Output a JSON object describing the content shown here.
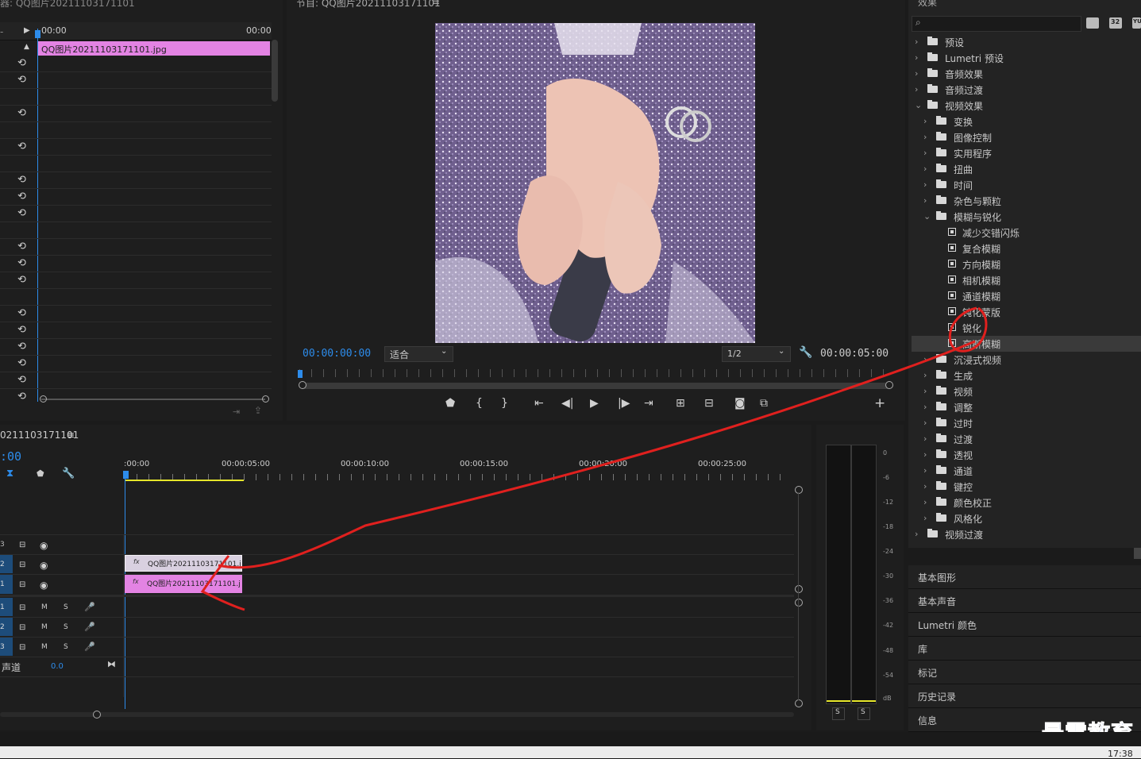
{
  "source_panel": {
    "title": "器: QQ图片20211103171101",
    "time_start": "00:00",
    "time_end": "00:00",
    "clip_label": "QQ图片20211103171101.jpg"
  },
  "program_panel": {
    "title": "节目: QQ图片20211103171101",
    "menu_glyph": "≡",
    "current_time": "00:00:00:00",
    "fit_label": "适合",
    "resolution": "1/2",
    "duration": "00:00:05:00"
  },
  "timeline": {
    "sequence_title": "0211103171101",
    "menu_glyph": "≡",
    "playhead": ":00",
    "ruler": [
      ":00:00",
      "00:00:05:00",
      "00:00:10:00",
      "00:00:15:00",
      "00:00:20:00",
      "00:00:25:00"
    ],
    "video_tracks": [
      {
        "id": "3"
      },
      {
        "id": "2",
        "clip": "QQ图片20211103171101.j"
      },
      {
        "id": "1",
        "clip": "QQ图片20211103171101.j"
      }
    ],
    "audio_tracks": [
      {
        "id": "1",
        "m": "M",
        "s": "S"
      },
      {
        "id": "2",
        "m": "M",
        "s": "S"
      },
      {
        "id": "3",
        "m": "M",
        "s": "S"
      }
    ],
    "master_label": "声道",
    "master_value": "0.0",
    "fx_badge": "fx"
  },
  "audio_meter": {
    "scale": [
      "0",
      "-6",
      "-12",
      "-18",
      "-24",
      "-30",
      "-36",
      "-42",
      "-48",
      "-54",
      "dB"
    ],
    "solo_left": "S",
    "solo_right": "S"
  },
  "effects_panel": {
    "title": "效果",
    "tree": [
      {
        "label": "预设",
        "level": 0,
        "kind": "folder",
        "state": "collapsed"
      },
      {
        "label": "Lumetri 预设",
        "level": 0,
        "kind": "folder",
        "state": "collapsed"
      },
      {
        "label": "音频效果",
        "level": 0,
        "kind": "folder",
        "state": "collapsed"
      },
      {
        "label": "音频过渡",
        "level": 0,
        "kind": "folder",
        "state": "collapsed"
      },
      {
        "label": "视频效果",
        "level": 0,
        "kind": "folder",
        "state": "expanded"
      },
      {
        "label": "变换",
        "level": 1,
        "kind": "folder",
        "state": "collapsed"
      },
      {
        "label": "图像控制",
        "level": 1,
        "kind": "folder",
        "state": "collapsed"
      },
      {
        "label": "实用程序",
        "level": 1,
        "kind": "folder",
        "state": "collapsed"
      },
      {
        "label": "扭曲",
        "level": 1,
        "kind": "folder",
        "state": "collapsed"
      },
      {
        "label": "时间",
        "level": 1,
        "kind": "folder",
        "state": "collapsed"
      },
      {
        "label": "杂色与颗粒",
        "level": 1,
        "kind": "folder",
        "state": "collapsed"
      },
      {
        "label": "模糊与锐化",
        "level": 1,
        "kind": "folder",
        "state": "expanded"
      },
      {
        "label": "减少交错闪烁",
        "level": 2,
        "kind": "effect"
      },
      {
        "label": "复合模糊",
        "level": 2,
        "kind": "effect"
      },
      {
        "label": "方向模糊",
        "level": 2,
        "kind": "effect"
      },
      {
        "label": "相机模糊",
        "level": 2,
        "kind": "effect"
      },
      {
        "label": "通道模糊",
        "level": 2,
        "kind": "effect"
      },
      {
        "label": "钝化蒙版",
        "level": 2,
        "kind": "effect"
      },
      {
        "label": "锐化",
        "level": 2,
        "kind": "effect"
      },
      {
        "label": "高斯模糊",
        "level": 2,
        "kind": "effect",
        "selected": true
      },
      {
        "label": "沉浸式视频",
        "level": 1,
        "kind": "folder",
        "state": "collapsed"
      },
      {
        "label": "生成",
        "level": 1,
        "kind": "folder",
        "state": "collapsed"
      },
      {
        "label": "视频",
        "level": 1,
        "kind": "folder",
        "state": "collapsed"
      },
      {
        "label": "调整",
        "level": 1,
        "kind": "folder",
        "state": "collapsed"
      },
      {
        "label": "过时",
        "level": 1,
        "kind": "folder",
        "state": "collapsed"
      },
      {
        "label": "过渡",
        "level": 1,
        "kind": "folder",
        "state": "collapsed"
      },
      {
        "label": "透视",
        "level": 1,
        "kind": "folder",
        "state": "collapsed"
      },
      {
        "label": "通道",
        "level": 1,
        "kind": "folder",
        "state": "collapsed"
      },
      {
        "label": "键控",
        "level": 1,
        "kind": "folder",
        "state": "collapsed"
      },
      {
        "label": "颜色校正",
        "level": 1,
        "kind": "folder",
        "state": "collapsed"
      },
      {
        "label": "风格化",
        "level": 1,
        "kind": "folder",
        "state": "collapsed"
      },
      {
        "label": "视频过渡",
        "level": 0,
        "kind": "folder",
        "state": "collapsed"
      }
    ],
    "badge_32": "32",
    "badge_yuv": "YU"
  },
  "side_tabs": [
    "基本图形",
    "基本声音",
    "Lumetri 颜色",
    "库",
    "标记",
    "历史记录",
    "信息"
  ],
  "watermark": "最需教育",
  "taskbar_time": "17:38",
  "colors": {
    "accent_blue": "#2d8ceb",
    "clip_pink": "#e383e3",
    "annotation_red": "#e0201e",
    "work_area_yellow": "#e6e62a"
  }
}
